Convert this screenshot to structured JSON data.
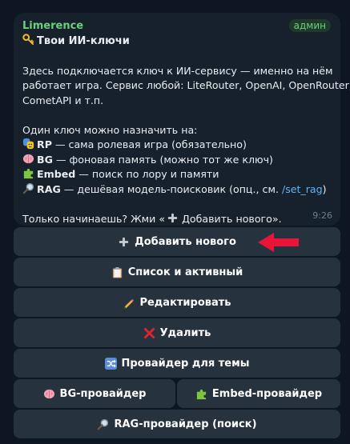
{
  "message": {
    "sender": "Limerence",
    "badge": "админ",
    "title": "Твои ИИ-ключи",
    "intro_line1": "Здесь подключается ключ к ИИ-сервису — именно на нём",
    "intro_line2": "работает игра. Сервис любой: LiteRouter, OpenAI, OpenRouter,",
    "intro_line3": "CometAPI и т.п.",
    "assign_header": "Один ключ можно назначить на:",
    "rp_label": "RP",
    "rp_text": " — сама ролевая игра (обязательно)",
    "bg_label": "BG",
    "bg_text": " — фоновая память (можно тот же ключ)",
    "embed_label": "Embed",
    "embed_text": " — поиск по лору и памяти",
    "rag_label": "RAG",
    "rag_text": " — дешёвая модель-поисковик (опц., см. ",
    "rag_link": "/set_rag",
    "rag_close": ")",
    "footer_text": "Только начинаешь? Жми «",
    "footer_btn": " Добавить нового",
    "footer_close": "».",
    "time": "9:26"
  },
  "keyboard": {
    "add_new": "Добавить нового",
    "list_active": "Список и активный",
    "edit": "Редактировать",
    "delete": "Удалить",
    "theme_provider": "Провайдер для темы",
    "bg_provider": "BG-провайдер",
    "embed_provider": "Embed-провайдер",
    "rag_provider": "RAG-провайдер (поиск)"
  },
  "colors": {
    "background": "#0e1621",
    "bubble": "#17212b",
    "button": "#26323e",
    "sender": "#6bd07c",
    "link": "#5eb5f7",
    "arrow": "#e8143a"
  },
  "icons": {
    "title": "key-icon",
    "rp": "theater-masks-icon",
    "bg": "brain-icon",
    "embed": "puzzle-icon",
    "rag": "magnifier-icon",
    "add": "plus-icon",
    "list": "clipboard-icon",
    "edit": "pencil-icon",
    "delete": "cross-icon",
    "theme": "shuffle-icon"
  }
}
